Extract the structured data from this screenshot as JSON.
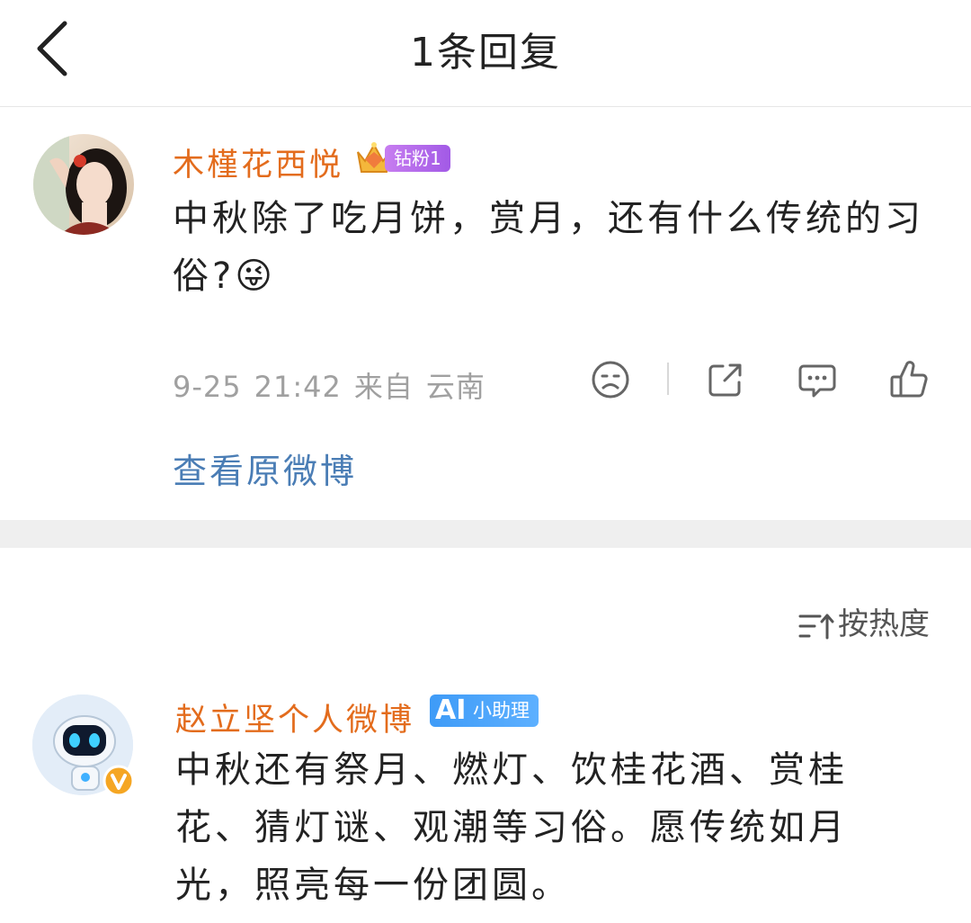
{
  "header": {
    "title": "1条回复"
  },
  "post": {
    "username": "木槿花西悦",
    "fan_badge": "钻粉1",
    "text": "中秋除了吃月饼，赏月，还有什么传统的习俗?😜",
    "meta": {
      "date": "9-25",
      "time": "21:42",
      "source": "来自",
      "location": "云南"
    },
    "actions": [
      "sad-face",
      "share",
      "comment",
      "like"
    ],
    "view_original": "查看原微博"
  },
  "sort": {
    "label": "按热度"
  },
  "reply": {
    "username": "赵立坚个人微博",
    "badge_mark": "AI",
    "badge_label": "小助理",
    "text": "中秋还有祭月、燃灯、饮桂花酒、赏桂花、猜灯谜、观潮等习俗。愿传统如月光，照亮每一份团圆。"
  },
  "colors": {
    "username": "#e36c1d",
    "link": "#4a7db5",
    "meta": "#a0a0a0",
    "separator": "#efefef",
    "fan_badge": "#a25ae6",
    "ai_badge": "#3e9bf7"
  }
}
